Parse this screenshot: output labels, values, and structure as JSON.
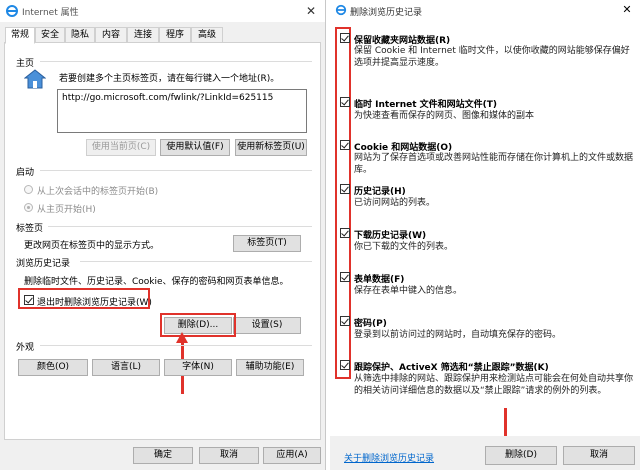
{
  "left_window": {
    "title": "Internet 属性",
    "close_icon": "close-icon",
    "tabs": [
      {
        "label": "常规"
      },
      {
        "label": "安全"
      },
      {
        "label": "隐私"
      },
      {
        "label": "内容"
      },
      {
        "label": "连接"
      },
      {
        "label": "程序"
      },
      {
        "label": "高级"
      }
    ],
    "home": {
      "label": "主页",
      "description": "若要创建多个主页标签页，请在每行键入一个地址(R)。",
      "url": "http://go.microsoft.com/fwlink/?LinkId=625115",
      "use_current": "使用当前页(C)",
      "use_default": "使用默认值(F)",
      "use_new_tab": "使用新标签页(U)"
    },
    "startup": {
      "label": "启动",
      "option_last_session": "从上次会话中的标签页开始(B)",
      "option_home": "从主页开始(H)"
    },
    "tabs_section": {
      "label": "标签页",
      "description": "更改网页在标签页中的显示方式。",
      "button": "标签页(T)"
    },
    "history": {
      "label": "浏览历史记录",
      "description": "删除临时文件、历史记录、Cookie、保存的密码和网页表单信息。",
      "delete_on_exit": "退出时删除浏览历史记录(W)",
      "delete_button": "删除(D)...",
      "settings_button": "设置(S)"
    },
    "appearance": {
      "label": "外观",
      "colors": "颜色(O)",
      "languages": "语言(L)",
      "fonts": "字体(N)",
      "accessibility": "辅助功能(E)"
    },
    "footer": {
      "ok": "确定",
      "cancel": "取消",
      "apply": "应用(A)"
    }
  },
  "right_window": {
    "title": "删除浏览历史记录",
    "items": [
      {
        "title": "保留收藏夹网站数据(R)",
        "desc": "保留 Cookie 和 Internet 临时文件，以使你收藏的网站能够保存偏好选项并提高显示速度。",
        "checked": true
      },
      {
        "title": "临时 Internet 文件和网站文件(T)",
        "desc": "为快速查看而保存的网页、图像和媒体的副本",
        "checked": true
      },
      {
        "title": "Cookie 和网站数据(O)",
        "desc": "网站为了保存首选项或改善网站性能而存储在你计算机上的文件或数据库。",
        "checked": true
      },
      {
        "title": "历史记录(H)",
        "desc": "已访问网站的列表。",
        "checked": true
      },
      {
        "title": "下载历史记录(W)",
        "desc": "你已下载的文件的列表。",
        "checked": true
      },
      {
        "title": "表单数据(F)",
        "desc": "保存在表单中键入的信息。",
        "checked": true
      },
      {
        "title": "密码(P)",
        "desc": "登录到以前访问过的网站时，自动填充保存的密码。",
        "checked": true
      },
      {
        "title": "跟踪保护、ActiveX 筛选和“禁止跟踪”数据(K)",
        "desc": "从筛选中排除的网站、跟踪保护用来检测站点可能会在何处自动共享你的相关访问详细信息的数据以及“禁止跟踪”请求的例外的列表。",
        "checked": true
      }
    ],
    "about_link": "关于删除浏览历史记录",
    "delete_button": "删除(D)",
    "cancel_button": "取消"
  },
  "colors": {
    "annotation_red": "#e0322b",
    "link_blue": "#0066cc"
  }
}
